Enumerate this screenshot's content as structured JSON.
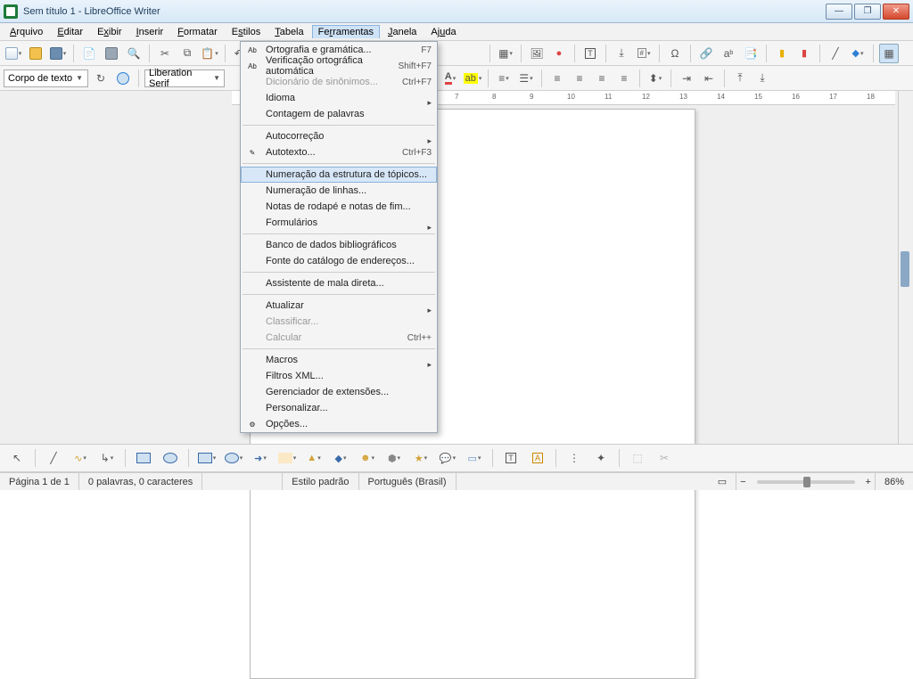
{
  "window": {
    "title": "Sem título 1 - LibreOffice Writer"
  },
  "menubar": {
    "items": [
      "Arquivo",
      "Editar",
      "Exibir",
      "Inserir",
      "Formatar",
      "Estilos",
      "Tabela",
      "Ferramentas",
      "Janela",
      "Ajuda"
    ],
    "activeIndex": 7
  },
  "style_combo": "Corpo de texto",
  "font_combo": "Liberation Serif",
  "dropdown": {
    "items": [
      {
        "label": "Ortografia e gramática...",
        "shortcut": "F7",
        "icon": "abc"
      },
      {
        "label": "Verificação ortográfica automática",
        "shortcut": "Shift+F7",
        "icon": "abc-check"
      },
      {
        "label": "Dicionário de sinônimos...",
        "shortcut": "Ctrl+F7",
        "disabled": true
      },
      {
        "label": "Idioma",
        "submenu": true
      },
      {
        "label": "Contagem de palavras"
      },
      {
        "sep": true
      },
      {
        "label": "Autocorreção",
        "submenu": true
      },
      {
        "label": "Autotexto...",
        "shortcut": "Ctrl+F3",
        "icon": "at"
      },
      {
        "sep": true
      },
      {
        "label": "Numeração da estrutura de tópicos...",
        "highlight": true
      },
      {
        "label": "Numeração de linhas..."
      },
      {
        "label": "Notas de rodapé e notas de fim..."
      },
      {
        "label": "Formulários",
        "submenu": true
      },
      {
        "sep": true
      },
      {
        "label": "Banco de dados bibliográficos"
      },
      {
        "label": "Fonte do catálogo de endereços..."
      },
      {
        "sep": true
      },
      {
        "label": "Assistente de mala direta..."
      },
      {
        "sep": true
      },
      {
        "label": "Atualizar",
        "submenu": true
      },
      {
        "label": "Classificar...",
        "disabled": true
      },
      {
        "label": "Calcular",
        "shortcut": "Ctrl++",
        "disabled": true
      },
      {
        "sep": true
      },
      {
        "label": "Macros",
        "submenu": true
      },
      {
        "label": "Filtros XML..."
      },
      {
        "label": "Gerenciador de extensões..."
      },
      {
        "label": "Personalizar..."
      },
      {
        "label": "Opções...",
        "icon": "gear"
      }
    ]
  },
  "ruler_ticks": [
    "7",
    "8",
    "9",
    "10",
    "11",
    "12",
    "13",
    "14",
    "15",
    "16",
    "17",
    "18"
  ],
  "status": {
    "page": "Página 1 de 1",
    "words": "0 palavras, 0 caracteres",
    "style": "Estilo padrão",
    "lang": "Português (Brasil)",
    "zoom": "86%"
  }
}
